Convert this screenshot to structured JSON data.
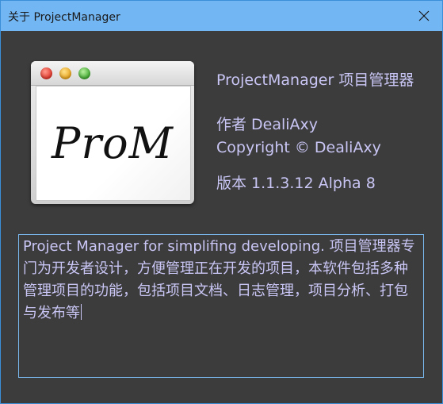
{
  "window": {
    "title": "关于 ProjectManager"
  },
  "logo": {
    "text": "ProM"
  },
  "info": {
    "product_name": "ProjectManager 项目管理器",
    "author": "作者 DealiAxy",
    "copyright": "Copyright © DealiAxy",
    "version": "版本 1.1.3.12 Alpha 8"
  },
  "description": {
    "text": "Project Manager for simplifing developing. 项目管理器专门为开发者设计，方便管理正在开发的项目，本软件包括多种管理项目的功能，包括项目文档、日志管理，项目分析、打包与发布等"
  },
  "colors": {
    "titlebar": "#72b6f4",
    "background": "#3c3c3c",
    "text": "#c9c6f5",
    "border": "#7ab8f0"
  }
}
